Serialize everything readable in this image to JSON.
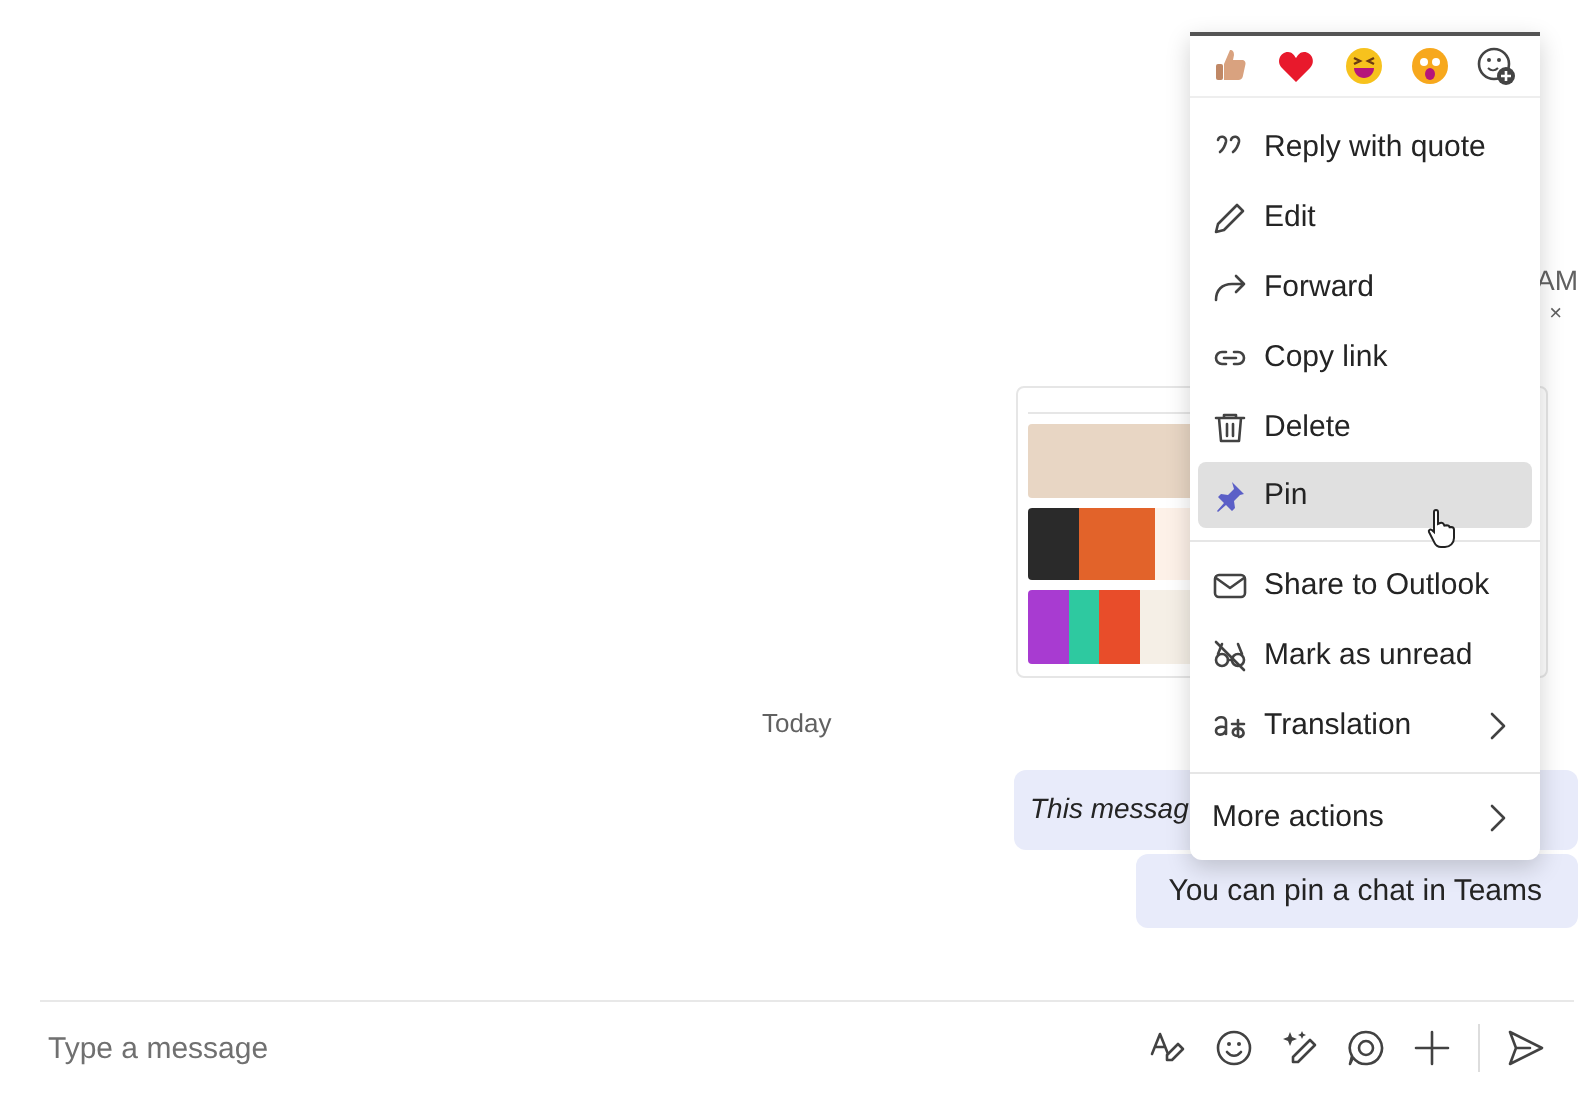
{
  "earlier_message": {
    "time": "AM",
    "close": "×"
  },
  "date_divider": "Today",
  "messages": [
    {
      "text": "This messag",
      "italic": true
    },
    {
      "text": "You can pin a chat in Teams",
      "italic": false
    }
  ],
  "context_menu": {
    "reactions": [
      {
        "kind": "like"
      },
      {
        "kind": "heart"
      },
      {
        "kind": "laugh"
      },
      {
        "kind": "surprised"
      },
      {
        "kind": "add"
      }
    ],
    "sections": [
      {
        "items": [
          {
            "kind": "quote",
            "label": "Reply with quote",
            "selected": false,
            "submenu": false
          },
          {
            "kind": "edit",
            "label": "Edit",
            "selected": false,
            "submenu": false
          },
          {
            "kind": "forward",
            "label": "Forward",
            "selected": false,
            "submenu": false
          },
          {
            "kind": "link",
            "label": "Copy link",
            "selected": false,
            "submenu": false
          },
          {
            "kind": "delete",
            "label": "Delete",
            "selected": false,
            "submenu": false
          },
          {
            "kind": "pin",
            "label": "Pin",
            "selected": true,
            "submenu": false
          }
        ]
      },
      {
        "items": [
          {
            "kind": "mail",
            "label": "Share to Outlook",
            "selected": false,
            "submenu": false
          },
          {
            "kind": "unread",
            "label": "Mark as unread",
            "selected": false,
            "submenu": false
          },
          {
            "kind": "translate",
            "label": "Translation",
            "selected": false,
            "submenu": true
          }
        ]
      },
      {
        "items": [
          {
            "kind": "none",
            "label": "More actions",
            "selected": false,
            "submenu": true
          }
        ]
      }
    ]
  },
  "compose": {
    "placeholder": "Type a message",
    "tools": [
      {
        "kind": "format"
      },
      {
        "kind": "emoji"
      },
      {
        "kind": "copilot"
      },
      {
        "kind": "loop"
      },
      {
        "kind": "attach"
      },
      {
        "kind": "send"
      }
    ]
  }
}
